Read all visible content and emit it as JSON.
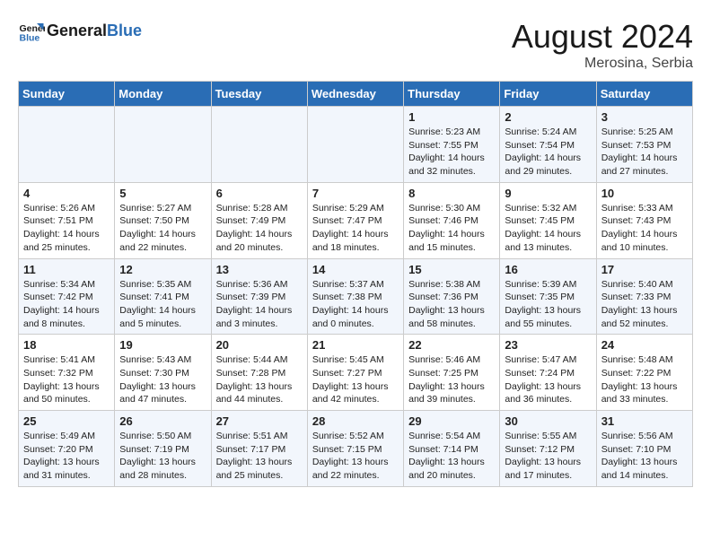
{
  "header": {
    "logo_general": "General",
    "logo_blue": "Blue",
    "month_year": "August 2024",
    "location": "Merosina, Serbia"
  },
  "days_of_week": [
    "Sunday",
    "Monday",
    "Tuesday",
    "Wednesday",
    "Thursday",
    "Friday",
    "Saturday"
  ],
  "weeks": [
    [
      {
        "day": "",
        "info": ""
      },
      {
        "day": "",
        "info": ""
      },
      {
        "day": "",
        "info": ""
      },
      {
        "day": "",
        "info": ""
      },
      {
        "day": "1",
        "info": "Sunrise: 5:23 AM\nSunset: 7:55 PM\nDaylight: 14 hours and 32 minutes."
      },
      {
        "day": "2",
        "info": "Sunrise: 5:24 AM\nSunset: 7:54 PM\nDaylight: 14 hours and 29 minutes."
      },
      {
        "day": "3",
        "info": "Sunrise: 5:25 AM\nSunset: 7:53 PM\nDaylight: 14 hours and 27 minutes."
      }
    ],
    [
      {
        "day": "4",
        "info": "Sunrise: 5:26 AM\nSunset: 7:51 PM\nDaylight: 14 hours and 25 minutes."
      },
      {
        "day": "5",
        "info": "Sunrise: 5:27 AM\nSunset: 7:50 PM\nDaylight: 14 hours and 22 minutes."
      },
      {
        "day": "6",
        "info": "Sunrise: 5:28 AM\nSunset: 7:49 PM\nDaylight: 14 hours and 20 minutes."
      },
      {
        "day": "7",
        "info": "Sunrise: 5:29 AM\nSunset: 7:47 PM\nDaylight: 14 hours and 18 minutes."
      },
      {
        "day": "8",
        "info": "Sunrise: 5:30 AM\nSunset: 7:46 PM\nDaylight: 14 hours and 15 minutes."
      },
      {
        "day": "9",
        "info": "Sunrise: 5:32 AM\nSunset: 7:45 PM\nDaylight: 14 hours and 13 minutes."
      },
      {
        "day": "10",
        "info": "Sunrise: 5:33 AM\nSunset: 7:43 PM\nDaylight: 14 hours and 10 minutes."
      }
    ],
    [
      {
        "day": "11",
        "info": "Sunrise: 5:34 AM\nSunset: 7:42 PM\nDaylight: 14 hours and 8 minutes."
      },
      {
        "day": "12",
        "info": "Sunrise: 5:35 AM\nSunset: 7:41 PM\nDaylight: 14 hours and 5 minutes."
      },
      {
        "day": "13",
        "info": "Sunrise: 5:36 AM\nSunset: 7:39 PM\nDaylight: 14 hours and 3 minutes."
      },
      {
        "day": "14",
        "info": "Sunrise: 5:37 AM\nSunset: 7:38 PM\nDaylight: 14 hours and 0 minutes."
      },
      {
        "day": "15",
        "info": "Sunrise: 5:38 AM\nSunset: 7:36 PM\nDaylight: 13 hours and 58 minutes."
      },
      {
        "day": "16",
        "info": "Sunrise: 5:39 AM\nSunset: 7:35 PM\nDaylight: 13 hours and 55 minutes."
      },
      {
        "day": "17",
        "info": "Sunrise: 5:40 AM\nSunset: 7:33 PM\nDaylight: 13 hours and 52 minutes."
      }
    ],
    [
      {
        "day": "18",
        "info": "Sunrise: 5:41 AM\nSunset: 7:32 PM\nDaylight: 13 hours and 50 minutes."
      },
      {
        "day": "19",
        "info": "Sunrise: 5:43 AM\nSunset: 7:30 PM\nDaylight: 13 hours and 47 minutes."
      },
      {
        "day": "20",
        "info": "Sunrise: 5:44 AM\nSunset: 7:28 PM\nDaylight: 13 hours and 44 minutes."
      },
      {
        "day": "21",
        "info": "Sunrise: 5:45 AM\nSunset: 7:27 PM\nDaylight: 13 hours and 42 minutes."
      },
      {
        "day": "22",
        "info": "Sunrise: 5:46 AM\nSunset: 7:25 PM\nDaylight: 13 hours and 39 minutes."
      },
      {
        "day": "23",
        "info": "Sunrise: 5:47 AM\nSunset: 7:24 PM\nDaylight: 13 hours and 36 minutes."
      },
      {
        "day": "24",
        "info": "Sunrise: 5:48 AM\nSunset: 7:22 PM\nDaylight: 13 hours and 33 minutes."
      }
    ],
    [
      {
        "day": "25",
        "info": "Sunrise: 5:49 AM\nSunset: 7:20 PM\nDaylight: 13 hours and 31 minutes."
      },
      {
        "day": "26",
        "info": "Sunrise: 5:50 AM\nSunset: 7:19 PM\nDaylight: 13 hours and 28 minutes."
      },
      {
        "day": "27",
        "info": "Sunrise: 5:51 AM\nSunset: 7:17 PM\nDaylight: 13 hours and 25 minutes."
      },
      {
        "day": "28",
        "info": "Sunrise: 5:52 AM\nSunset: 7:15 PM\nDaylight: 13 hours and 22 minutes."
      },
      {
        "day": "29",
        "info": "Sunrise: 5:54 AM\nSunset: 7:14 PM\nDaylight: 13 hours and 20 minutes."
      },
      {
        "day": "30",
        "info": "Sunrise: 5:55 AM\nSunset: 7:12 PM\nDaylight: 13 hours and 17 minutes."
      },
      {
        "day": "31",
        "info": "Sunrise: 5:56 AM\nSunset: 7:10 PM\nDaylight: 13 hours and 14 minutes."
      }
    ]
  ]
}
